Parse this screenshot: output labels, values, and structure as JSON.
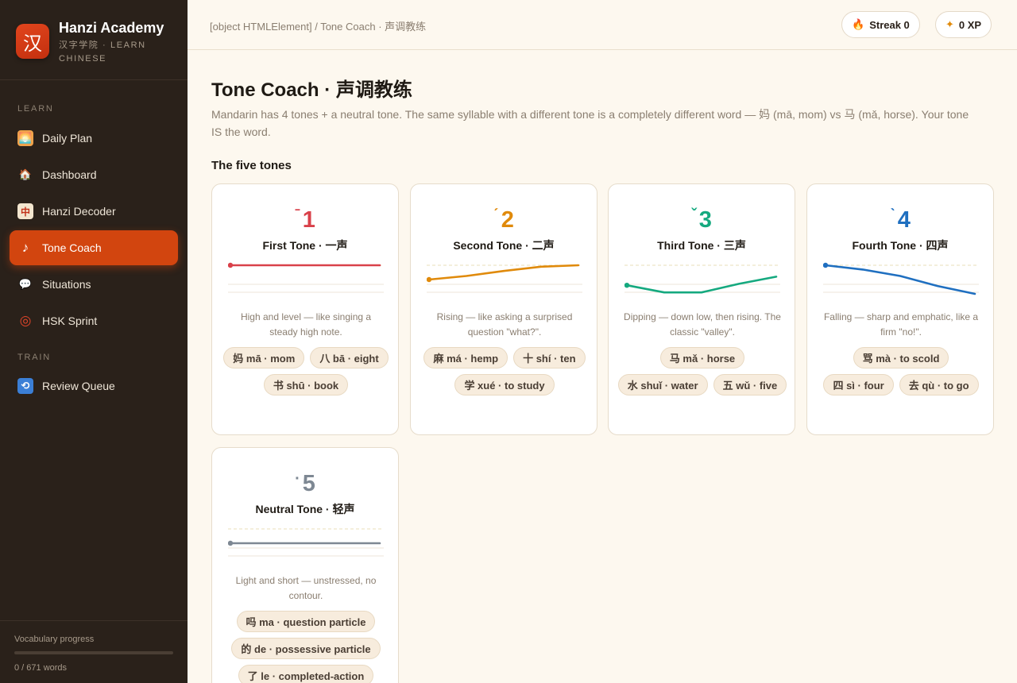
{
  "brand": {
    "logo_char": "汉",
    "title": "Hanzi Academy",
    "subtitle": "汉字学院 · LEARN CHINESE"
  },
  "sidebar": {
    "sections": [
      {
        "label": "LEARN"
      },
      {
        "label": "TRAIN"
      }
    ],
    "items": [
      {
        "label": "Daily Plan",
        "icon": "sunrise-icon",
        "glyph": "🌅"
      },
      {
        "label": "Dashboard",
        "icon": "house-icon",
        "glyph": "🏠"
      },
      {
        "label": "Hanzi Decoder",
        "icon": "mahjong-tile-icon",
        "glyph": "中"
      },
      {
        "label": "Tone Coach",
        "icon": "music-note-icon",
        "glyph": "♪",
        "active": true
      },
      {
        "label": "Situations",
        "icon": "speech-bubble-icon",
        "glyph": "💬"
      },
      {
        "label": "HSK Sprint",
        "icon": "target-icon",
        "glyph": "◎"
      },
      {
        "label": "Review Queue",
        "icon": "repeat-icon",
        "glyph": "⟲"
      }
    ],
    "footer": {
      "label": "Vocabulary progress",
      "count": "0 / 671 words",
      "progress": 0
    }
  },
  "topbar": {
    "breadcrumb": "[object HTMLElement] / Tone Coach · 声调教练",
    "streak": {
      "icon": "flame-icon",
      "glyph": "🔥",
      "label": "Streak 0"
    },
    "xp": {
      "icon": "sparkle-icon",
      "glyph": "✦",
      "label": "0 XP"
    }
  },
  "main": {
    "title": "Tone Coach · 声调教练",
    "intro": "Mandarin has 4 tones + a neutral tone. The same syllable with a different tone is a completely different word — 妈 (mā, mom) vs 马 (mǎ, horse). Your tone IS the word.",
    "section_title": "The five tones",
    "tones": [
      {
        "mark": "ˉ",
        "number": "1",
        "name": "First Tone · 一声",
        "color": "#d9414a",
        "contour": [
          5,
          5,
          5,
          5,
          5
        ],
        "description": "High and level — like singing a steady high note.",
        "examples": [
          "妈 mā · mom",
          "八 bā · eight",
          "书 shū · book"
        ]
      },
      {
        "mark": "ˊ",
        "number": "2",
        "name": "Second Tone · 二声",
        "color": "#e08a0b",
        "contour": [
          3,
          3.5,
          4.2,
          4.8,
          5
        ],
        "description": "Rising — like asking a surprised question \"what?\".",
        "examples": [
          "麻 má · hemp",
          "十 shí · ten",
          "学 xué · to study"
        ]
      },
      {
        "mark": "ˇ",
        "number": "3",
        "name": "Third Tone · 三声",
        "color": "#15a97f",
        "contour": [
          2.2,
          1.2,
          1.2,
          2.4,
          3.4
        ],
        "description": "Dipping — down low, then rising. The classic \"valley\".",
        "examples": [
          "马 mǎ · horse",
          "水 shuǐ · water",
          "五 wǔ · five"
        ]
      },
      {
        "mark": "ˋ",
        "number": "4",
        "name": "Fourth Tone · 四声",
        "color": "#1f6fc0",
        "contour": [
          5,
          4.4,
          3.5,
          2.1,
          1
        ],
        "description": "Falling — sharp and emphatic, like a firm \"no!\".",
        "examples": [
          "骂 mà · to scold",
          "四 sì · four",
          "去 qù · to go"
        ]
      },
      {
        "mark": "·",
        "number": "5",
        "name": "Neutral Tone · 轻声",
        "color": "#7e8893",
        "contour": [
          3,
          3,
          3,
          3,
          3
        ],
        "description": "Light and short — unstressed, no contour.",
        "examples": [
          "吗 ma · question particle",
          "的 de · possessive particle",
          "了 le · completed-action"
        ]
      }
    ]
  }
}
